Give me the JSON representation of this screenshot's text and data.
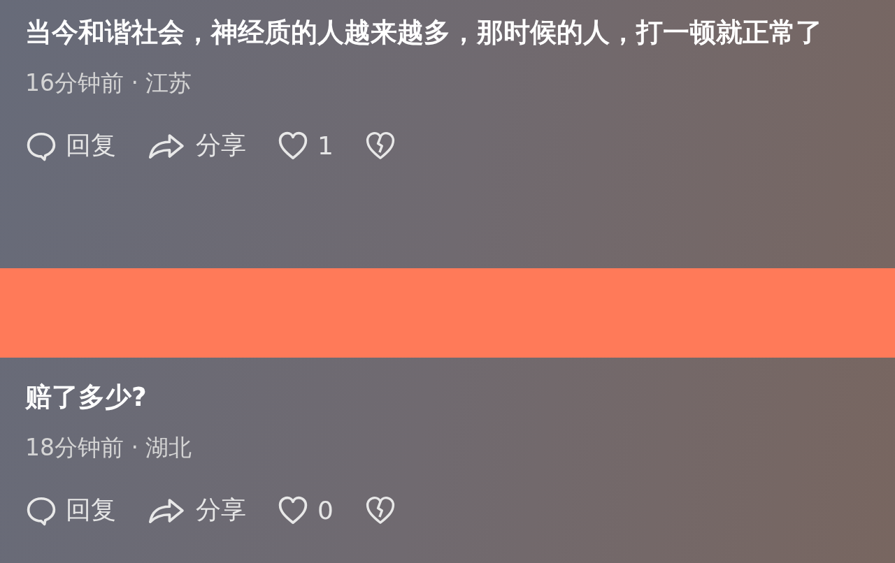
{
  "comments": [
    {
      "text": "当今和谐社会，神经质的人越来越多，那时候的人，打一顿就正常了",
      "meta": "16分钟前 · 江苏",
      "reply": "回复",
      "share": "分享",
      "likes": "1"
    },
    {
      "text": "赔了多少?",
      "meta": "18分钟前 · 湖北",
      "reply": "回复",
      "share": "分享",
      "likes": "0"
    }
  ]
}
